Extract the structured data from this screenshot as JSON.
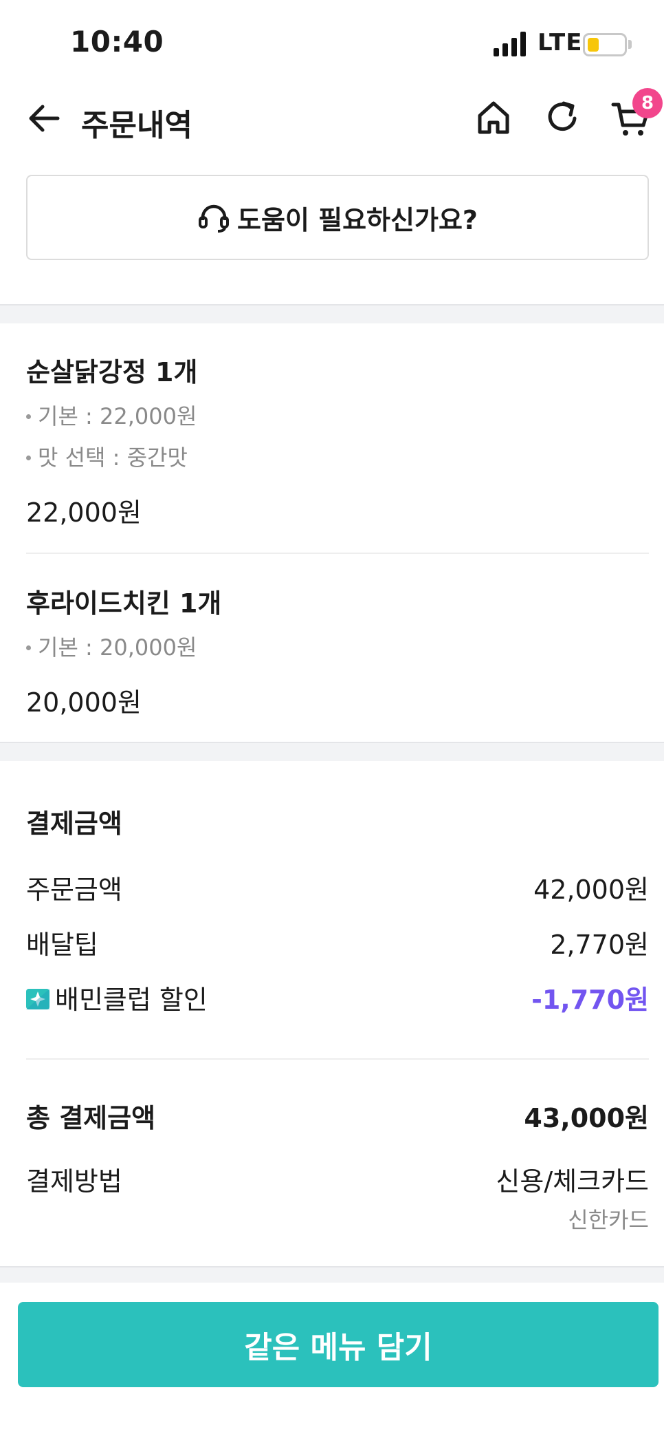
{
  "status_bar": {
    "time": "10:40",
    "network": "LTE",
    "battery_level": 0.3
  },
  "header": {
    "title": "주문내역",
    "cart_count": "8"
  },
  "help": {
    "label": "도움이 필요하신가요?"
  },
  "order_items": [
    {
      "name": "순살닭강정 1개",
      "options": [
        "기본 : 22,000원",
        "맛 선택 : 중간맛"
      ],
      "price": "22,000원"
    },
    {
      "name": "후라이드치킨 1개",
      "options": [
        "기본 : 20,000원"
      ],
      "price": "20,000원"
    }
  ],
  "payment": {
    "title": "결제금액",
    "order_amount_label": "주문금액",
    "order_amount": "42,000원",
    "delivery_tip_label": "배달팁",
    "delivery_tip": "2,770원",
    "club_discount_label": "배민클럽 할인",
    "club_discount": "-1,770원",
    "total_label": "총 결제금액",
    "total": "43,000원",
    "method_label": "결제방법",
    "method": "신용/체크카드",
    "card": "신한카드"
  },
  "cta": {
    "label": "같은 메뉴 담기"
  },
  "colors": {
    "accent": "#2bc1bc",
    "badge": "#f2468c",
    "discount": "#7255f0",
    "battery": "#f7c60a"
  }
}
